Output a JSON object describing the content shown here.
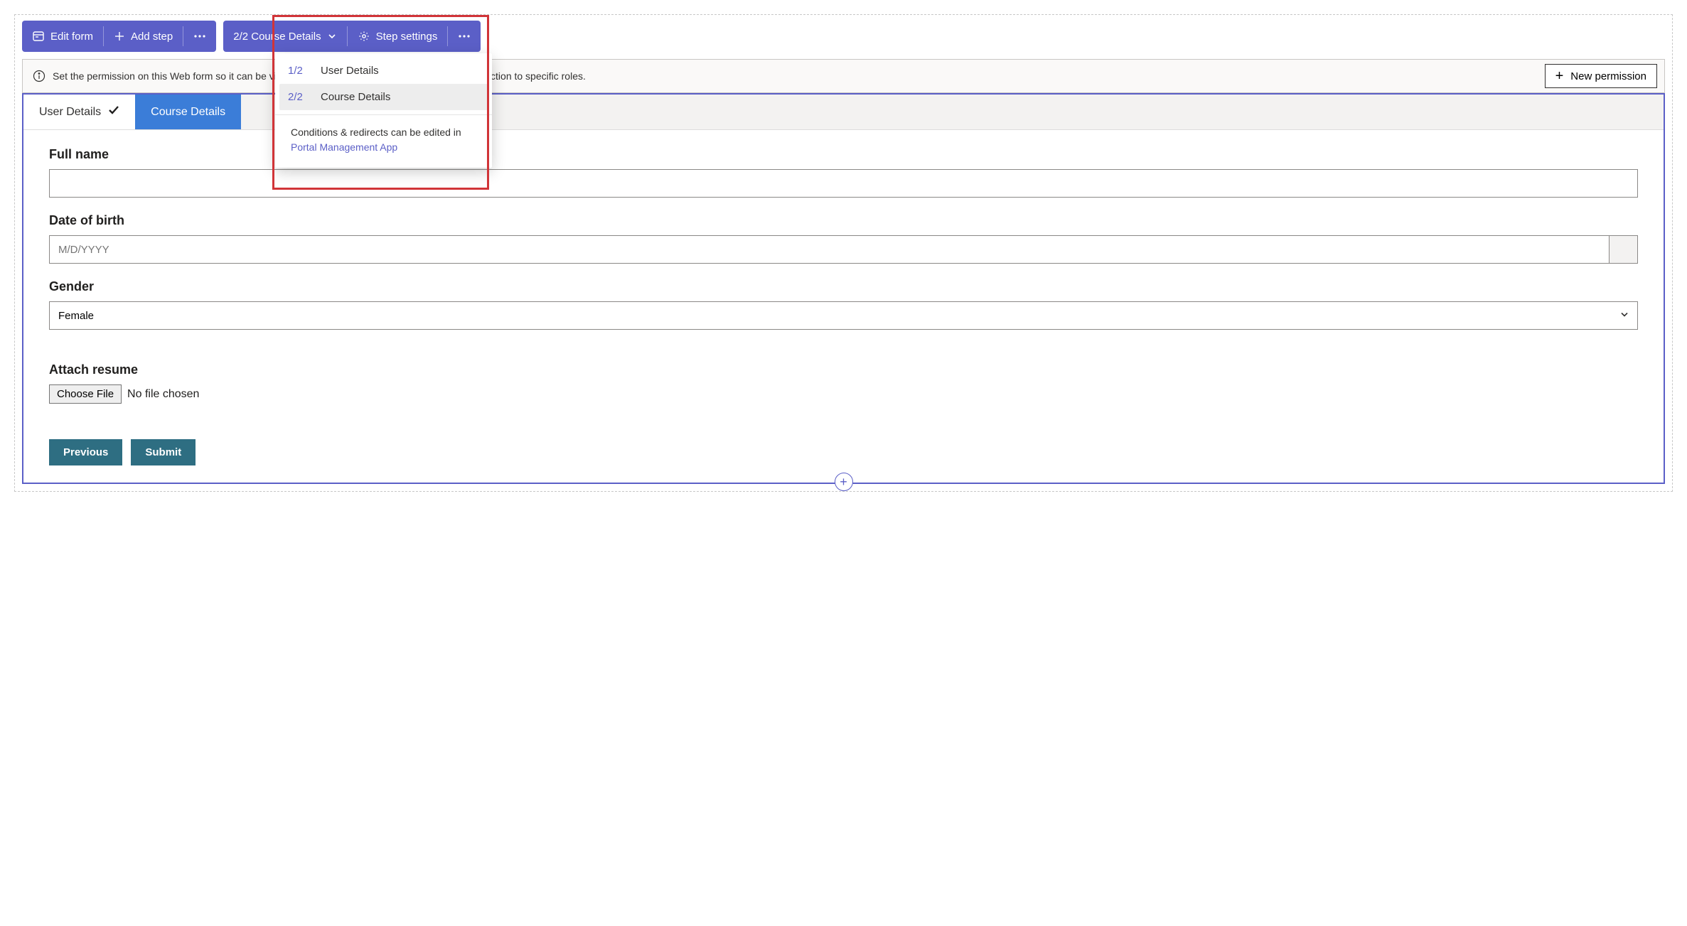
{
  "toolbar": {
    "edit_form": "Edit form",
    "add_step": "Add step",
    "current_step_label": "2/2 Course Details",
    "step_settings": "Step settings"
  },
  "step_dropdown": {
    "items": [
      {
        "fraction": "1/2",
        "name": "User Details"
      },
      {
        "fraction": "2/2",
        "name": "Course Details"
      }
    ],
    "footer_text": "Conditions & redirects can be edited in",
    "footer_link": "Portal Management App"
  },
  "permission_bar": {
    "text_full": "Set the permission on this Web form so it can be visible to anyone visiting the site, or limit the interaction to specific roles.",
    "button": "New permission"
  },
  "tabs": {
    "user_details": "User Details",
    "course_details": "Course Details"
  },
  "form": {
    "full_name": {
      "label": "Full name",
      "value": ""
    },
    "dob": {
      "label": "Date of birth",
      "placeholder": "M/D/YYYY"
    },
    "gender": {
      "label": "Gender",
      "value": "Female"
    },
    "resume": {
      "label": "Attach resume",
      "button": "Choose File",
      "status": "No file chosen"
    },
    "prev": "Previous",
    "submit": "Submit"
  }
}
